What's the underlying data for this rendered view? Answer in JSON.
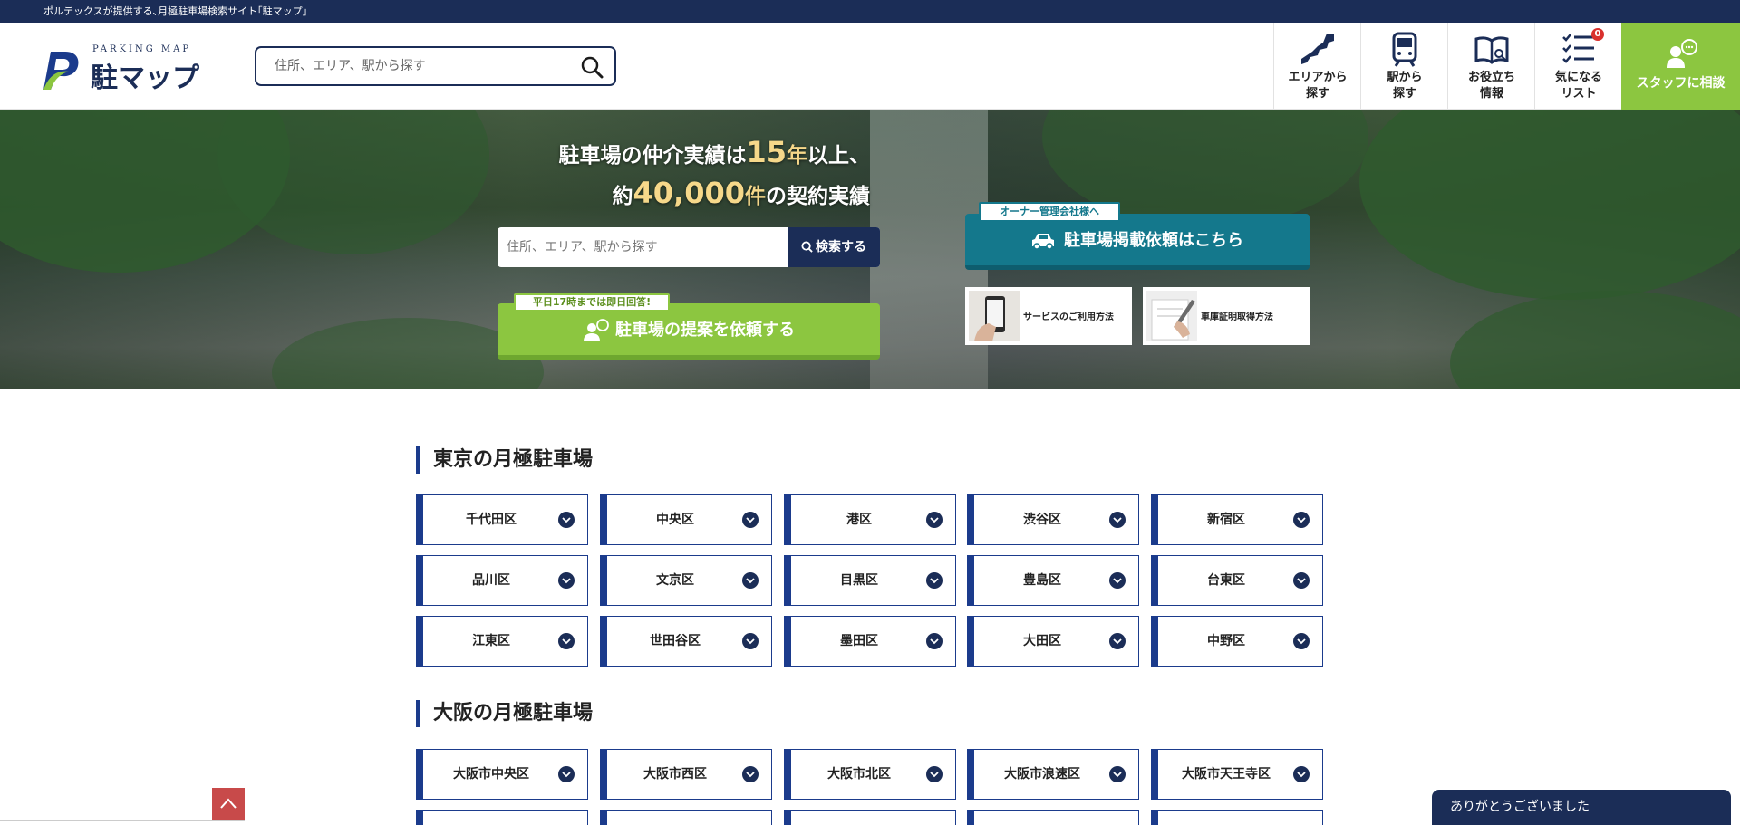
{
  "topbar": {
    "text": "ポルテックスが提供する､月極駐車場検索サイト｢駐マップ｣"
  },
  "logo": {
    "sub": "PARKING MAP",
    "main": "駐マップ"
  },
  "header_search": {
    "placeholder": "住所、エリア、駅から探す"
  },
  "nav": [
    {
      "label": "エリアから\n探す",
      "icon": "japan-map-icon"
    },
    {
      "label": "駅から\n探す",
      "icon": "train-icon"
    },
    {
      "label": "お役立ち\n情報",
      "icon": "book-icon"
    },
    {
      "label": "気になる\nリスト",
      "icon": "checklist-icon",
      "badge": "0"
    }
  ],
  "staff": {
    "label": "スタッフに相談"
  },
  "hero": {
    "line1_pre": "駐車場の仲介実績は",
    "line1_num": "15",
    "line1_unit": "年",
    "line1_post": "以上、",
    "line2_pre": "約",
    "line2_num": "40,000",
    "line2_unit": "件",
    "line2_post": "の契約実績",
    "search_placeholder": "住所、エリア、駅から探す",
    "search_button": "検索する",
    "propose_tag": "平日17時までは即日回答!",
    "propose_button": "駐車場の提案を依頼する",
    "owner_tag": "オーナー管理会社様へ",
    "owner_button": "駐車場掲載依頼はこちら",
    "card_service": "サービスのご利用方法",
    "card_certificate": "車庫証明取得方法"
  },
  "tokyo": {
    "title": "東京の月極駐車場",
    "areas": [
      "千代田区",
      "中央区",
      "港区",
      "渋谷区",
      "新宿区",
      "品川区",
      "文京区",
      "目黒区",
      "豊島区",
      "台東区",
      "江東区",
      "世田谷区",
      "墨田区",
      "大田区",
      "中野区"
    ]
  },
  "osaka": {
    "title": "大阪の月極駐車場",
    "areas": [
      "大阪市中央区",
      "大阪市西区",
      "大阪市北区",
      "大阪市浪速区",
      "大阪市天王寺区"
    ]
  },
  "chat": {
    "label": "ありがとうございました"
  },
  "colors": {
    "navy": "#1b2d57",
    "green": "#8cc640",
    "teal": "#14788c",
    "area_blue": "#1b3b8c"
  }
}
